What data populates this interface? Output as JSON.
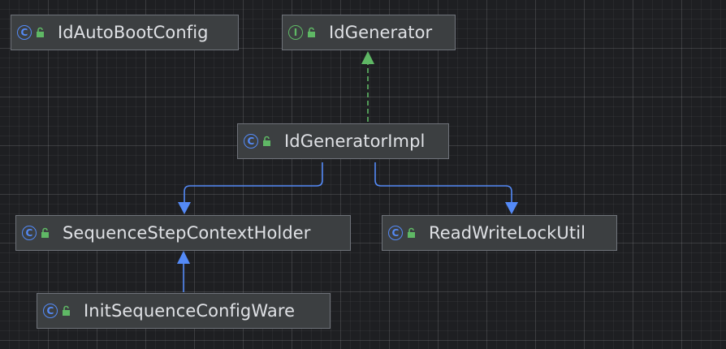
{
  "nodes": [
    {
      "id": "id-auto-boot-config",
      "label": "IdAutoBootConfig",
      "kind": "class",
      "kind_glyph": "C",
      "icon": "public-lock-icon"
    },
    {
      "id": "id-generator",
      "label": "IdGenerator",
      "kind": "interface",
      "kind_glyph": "I",
      "icon": "public-lock-icon"
    },
    {
      "id": "id-generator-impl",
      "label": "IdGeneratorImpl",
      "kind": "class",
      "kind_glyph": "C",
      "icon": "public-lock-icon"
    },
    {
      "id": "sequence-step-context-holder",
      "label": "SequenceStepContextHolder",
      "kind": "class",
      "kind_glyph": "C",
      "icon": "public-lock-icon"
    },
    {
      "id": "read-write-lock-util",
      "label": "ReadWriteLockUtil",
      "kind": "class",
      "kind_glyph": "C",
      "icon": "public-lock-icon"
    },
    {
      "id": "init-sequence-config-ware",
      "label": "InitSequenceConfigWare",
      "kind": "class",
      "kind_glyph": "C",
      "icon": "public-lock-icon"
    }
  ],
  "edges": [
    {
      "from": "id-generator-impl",
      "to": "id-generator",
      "type": "implements",
      "color": "#5fb865",
      "style": "dashed"
    },
    {
      "from": "id-generator-impl",
      "to": "sequence-step-context-holder",
      "type": "uses",
      "color": "#548af7",
      "style": "solid"
    },
    {
      "from": "id-generator-impl",
      "to": "read-write-lock-util",
      "type": "uses",
      "color": "#548af7",
      "style": "solid"
    },
    {
      "from": "init-sequence-config-ware",
      "to": "sequence-step-context-holder",
      "type": "extends",
      "color": "#548af7",
      "style": "solid"
    }
  ],
  "colors": {
    "background": "#1e1f22",
    "node_fill": "#3c3f41",
    "node_border": "#6f737a",
    "text": "#dfe1e5",
    "class_icon": "#548af7",
    "interface_icon": "#5fb865",
    "lock_icon": "#5fb865"
  }
}
